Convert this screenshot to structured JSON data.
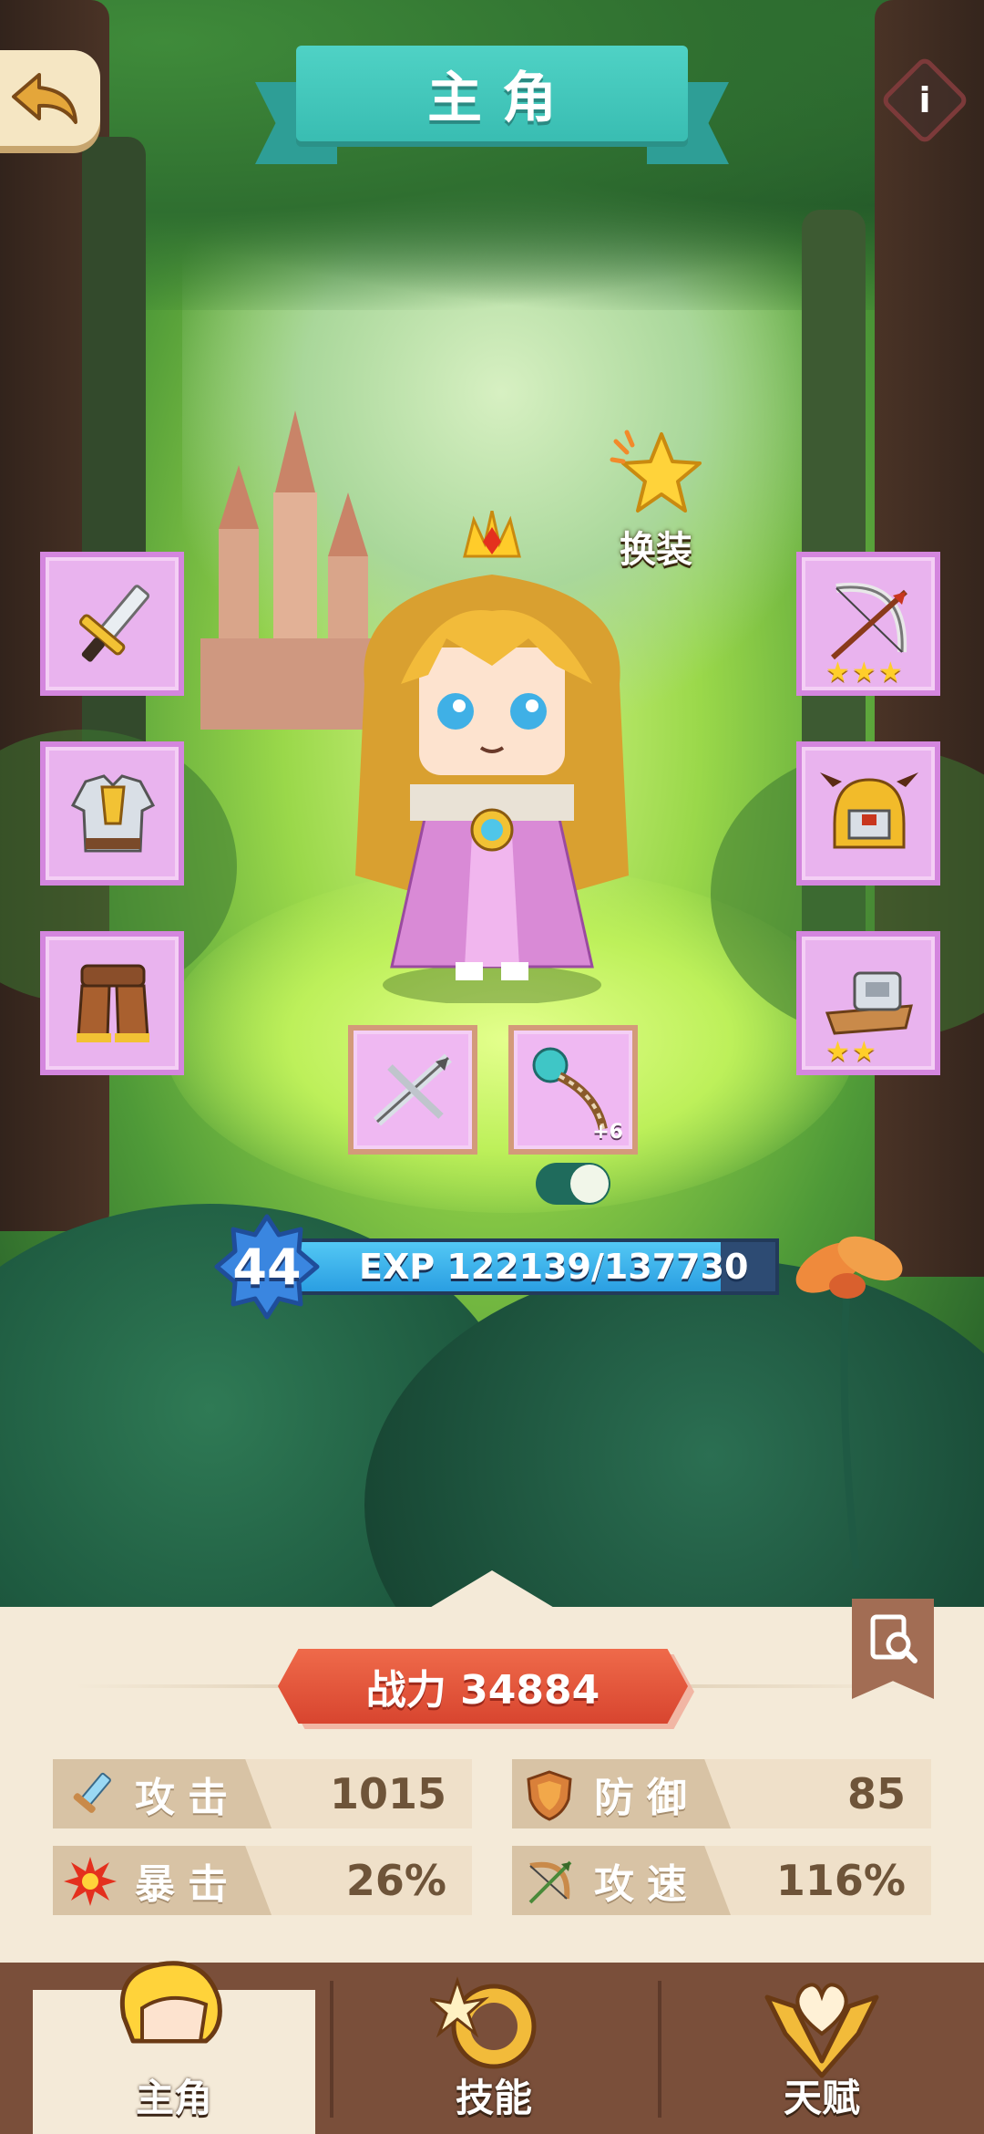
{
  "header": {
    "title": "主角"
  },
  "equipment": {
    "change_label": "换装",
    "left_slots": [
      {
        "item": "sword-icon"
      },
      {
        "item": "armor-icon"
      },
      {
        "item": "boots-icon"
      }
    ],
    "right_slots": [
      {
        "item": "bow-icon",
        "stars": 3
      },
      {
        "item": "helmet-icon"
      },
      {
        "item": "anvil-icon",
        "stars": 2
      }
    ],
    "bottom_slots": [
      {
        "item": "crossbow-icon"
      },
      {
        "item": "staff-icon",
        "enhance": "+6"
      }
    ]
  },
  "level": {
    "value": "44",
    "exp_text": "EXP 122139/137730",
    "exp_fraction": 0.887
  },
  "stats": {
    "power": "战力 34884",
    "items": [
      {
        "name": "攻击",
        "value": "1015",
        "icon": "sword-icon"
      },
      {
        "name": "防御",
        "value": "85",
        "icon": "shield-icon"
      },
      {
        "name": "暴击",
        "value": "26%",
        "icon": "burst-icon"
      },
      {
        "name": "攻速",
        "value": "116%",
        "icon": "bow-icon"
      }
    ]
  },
  "nav": {
    "tabs": [
      {
        "label": "主角",
        "icon": "hero-icon",
        "active": true
      },
      {
        "label": "技能",
        "icon": "skill-icon",
        "active": false
      },
      {
        "label": "天赋",
        "icon": "talent-icon",
        "active": false
      }
    ]
  },
  "colors": {
    "title_ribbon": "#3fc6ba",
    "slot_bg": "#e9b3ee",
    "exp_fill": "#2a9ee2",
    "power_banner": "#e0533a",
    "panel_bg": "#f4ead8",
    "nav_bg": "#7a4f3a"
  }
}
